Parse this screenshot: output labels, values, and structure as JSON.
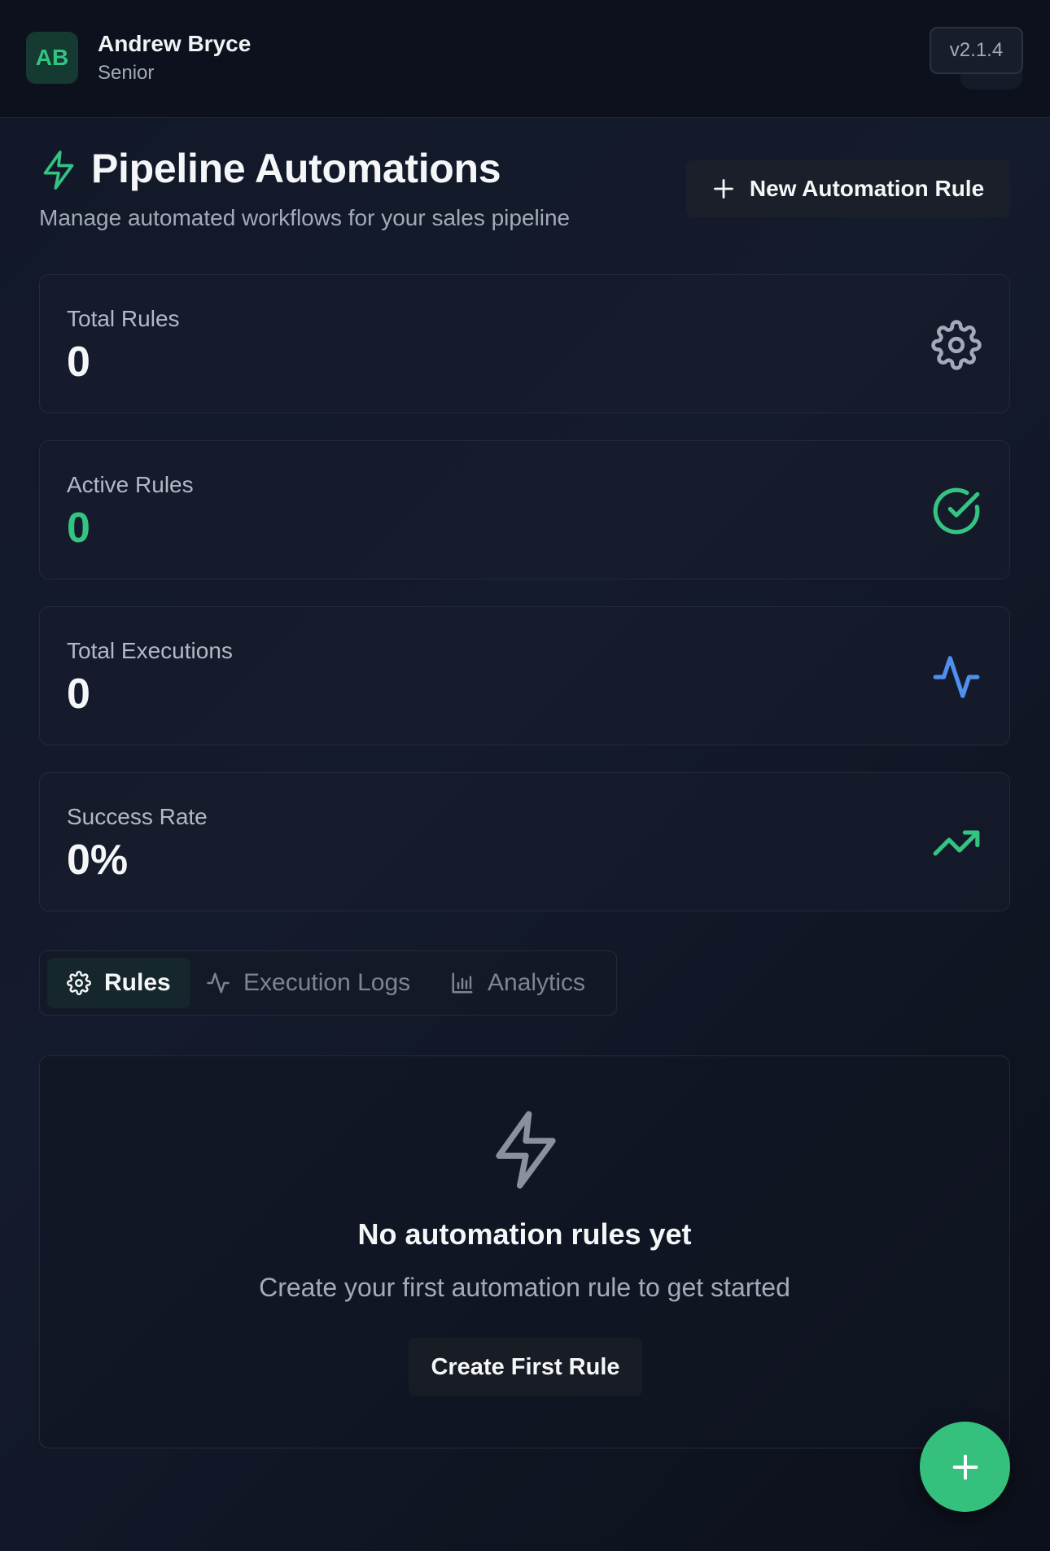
{
  "user": {
    "initials": "AB",
    "name": "Andrew Bryce",
    "role": "Senior"
  },
  "version": "v2.1.4",
  "page": {
    "title": "Pipeline Automations",
    "subtitle": "Manage automated workflows for your sales pipeline",
    "new_rule_label": "New Automation Rule"
  },
  "stats": [
    {
      "label": "Total Rules",
      "value": "0",
      "icon": "gear-icon"
    },
    {
      "label": "Active Rules",
      "value": "0",
      "icon": "check-circle-icon"
    },
    {
      "label": "Total Executions",
      "value": "0",
      "icon": "activity-icon"
    },
    {
      "label": "Success Rate",
      "value": "0%",
      "icon": "trending-up-icon"
    }
  ],
  "tabs": [
    {
      "label": "Rules",
      "icon": "gear-icon",
      "active": true
    },
    {
      "label": "Execution Logs",
      "icon": "activity-icon",
      "active": false
    },
    {
      "label": "Analytics",
      "icon": "bar-chart-icon",
      "active": false
    }
  ],
  "empty_state": {
    "icon": "zap-icon",
    "title": "No automation rules yet",
    "text": "Create your first automation rule to get started",
    "button_label": "Create First Rule"
  },
  "fab": {
    "icon": "plus-icon"
  },
  "colors": {
    "accent_green": "#34c482",
    "accent_blue": "#4f8ff0",
    "background": "#121828"
  }
}
